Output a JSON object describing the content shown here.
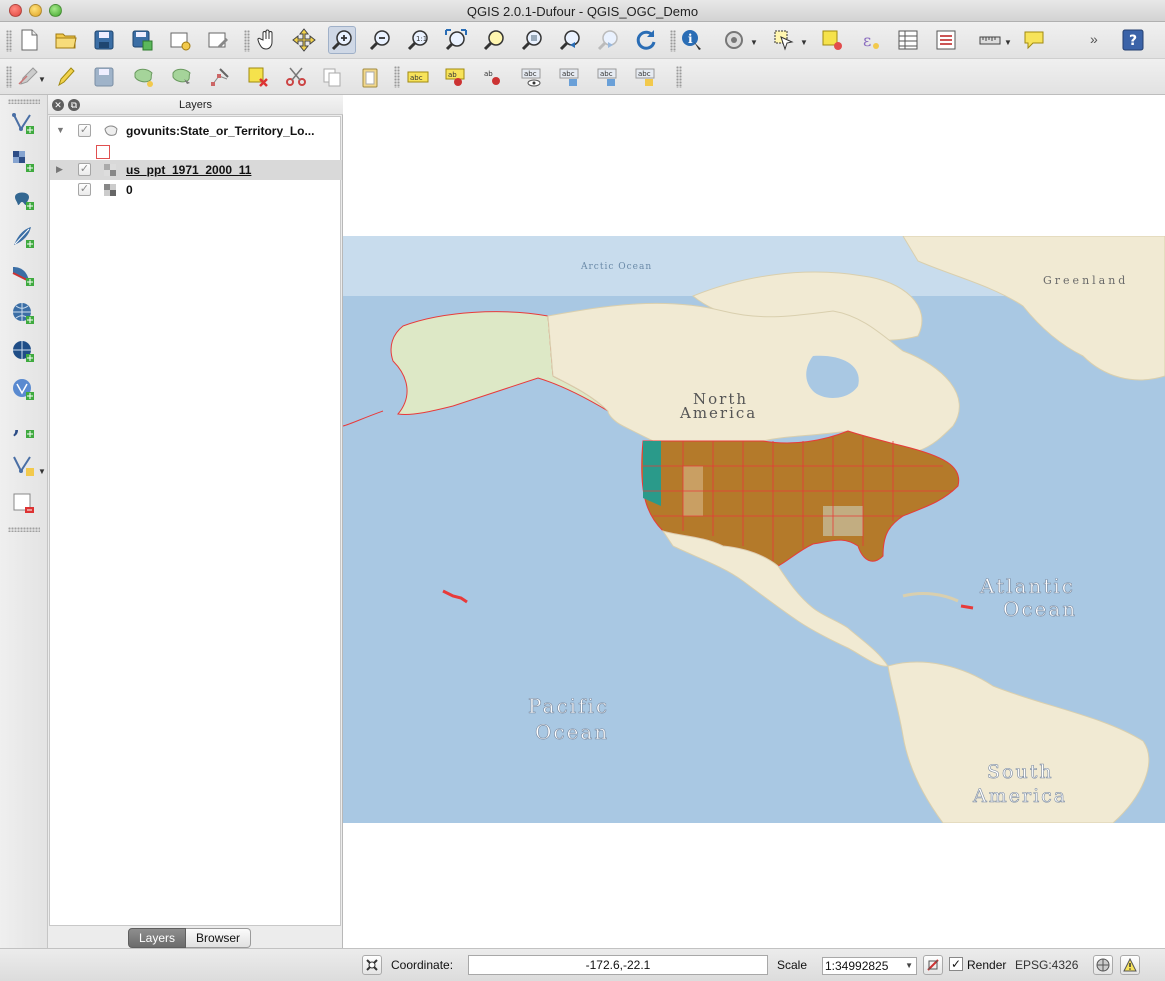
{
  "window": {
    "title": "QGIS 2.0.1-Dufour - QGIS_OGC_Demo"
  },
  "toolbar_file": [
    {
      "name": "new-project-icon"
    },
    {
      "name": "open-project-icon"
    },
    {
      "name": "save-project-icon"
    },
    {
      "name": "save-as-icon"
    },
    {
      "name": "new-print-composer-icon"
    },
    {
      "name": "composer-manager-icon"
    }
  ],
  "toolbar_map_nav": [
    {
      "name": "pan-icon"
    },
    {
      "name": "pan-to-selection-icon"
    },
    {
      "name": "zoom-in-icon"
    },
    {
      "name": "zoom-out-icon"
    },
    {
      "name": "zoom-actual-size-icon"
    },
    {
      "name": "zoom-full-icon"
    },
    {
      "name": "zoom-to-selection-icon"
    },
    {
      "name": "zoom-to-layer-icon"
    },
    {
      "name": "zoom-last-icon"
    },
    {
      "name": "zoom-next-icon"
    },
    {
      "name": "refresh-icon"
    }
  ],
  "toolbar_attributes": [
    {
      "name": "identify-icon"
    },
    {
      "name": "run-action-icon"
    },
    {
      "name": "select-features-icon"
    },
    {
      "name": "deselect-icon"
    },
    {
      "name": "field-calculator-icon"
    },
    {
      "name": "attribute-table-icon"
    },
    {
      "name": "statistics-icon"
    },
    {
      "name": "measure-icon"
    },
    {
      "name": "map-tips-icon"
    }
  ],
  "toolbar_overflow": "»",
  "toolbar_help": "?",
  "toolbar_digitize": [
    {
      "name": "current-edits-icon"
    },
    {
      "name": "toggle-editing-icon"
    },
    {
      "name": "save-layer-edits-icon"
    },
    {
      "name": "add-feature-icon"
    },
    {
      "name": "move-feature-icon"
    },
    {
      "name": "node-tool-icon"
    },
    {
      "name": "delete-selected-icon"
    },
    {
      "name": "cut-features-icon"
    },
    {
      "name": "copy-features-icon"
    },
    {
      "name": "paste-features-icon"
    }
  ],
  "toolbar_labels": [
    {
      "name": "layer-labeling-icon",
      "text": "abc"
    },
    {
      "name": "pin-label-icon",
      "text": "ab"
    },
    {
      "name": "highlight-pinned-label-icon",
      "text": "ab"
    },
    {
      "name": "show-hide-label-icon",
      "text": "abc"
    },
    {
      "name": "move-label-icon",
      "text": "abc"
    },
    {
      "name": "rotate-label-icon",
      "text": "abc"
    },
    {
      "name": "change-label-icon",
      "text": "abc"
    }
  ],
  "left_toolbar": [
    {
      "name": "add-vector-layer-icon"
    },
    {
      "name": "add-raster-layer-icon"
    },
    {
      "name": "add-postgis-layer-icon"
    },
    {
      "name": "add-spatialite-layer-icon"
    },
    {
      "name": "add-mssql-layer-icon"
    },
    {
      "name": "add-wms-layer-icon"
    },
    {
      "name": "add-wcs-layer-icon"
    },
    {
      "name": "add-wfs-layer-icon"
    },
    {
      "name": "add-delimited-text-icon"
    },
    {
      "name": "new-shapefile-layer-icon"
    },
    {
      "name": "remove-layer-icon"
    }
  ],
  "layers_panel": {
    "title": "Layers",
    "layers": [
      {
        "name": "govunits:State_or_Territory_Lo...",
        "checked": true,
        "expanded": true,
        "type": "vector"
      },
      {
        "name": "us_ppt_1971_2000_11",
        "checked": true,
        "expanded": false,
        "type": "raster"
      },
      {
        "name": "0",
        "checked": true,
        "expanded": false,
        "type": "raster"
      }
    ],
    "legend_color": "#e05050",
    "tabs": [
      {
        "label": "Layers",
        "active": true
      },
      {
        "label": "Browser",
        "active": false
      }
    ]
  },
  "map": {
    "labels": {
      "arctic": "Arctic Ocean",
      "greenland": "Greenland",
      "north_america": [
        "North",
        "America"
      ],
      "atlantic": [
        "Atlantic",
        "Ocean"
      ],
      "pacific": [
        "Pacific",
        "Ocean"
      ],
      "south_america": [
        "South",
        "America"
      ]
    },
    "colors": {
      "ocean": "#a9c8e3",
      "land": "#f1ead3",
      "raster": "#b47a2a",
      "state_lines": "#e83a3a"
    }
  },
  "status": {
    "coordinate_label": "Coordinate:",
    "coordinate_value": "-172.6,-22.1",
    "scale_label": "Scale",
    "scale_value": "1:34992825",
    "render_label": "Render",
    "render_checked": true,
    "crs": "EPSG:4326"
  }
}
